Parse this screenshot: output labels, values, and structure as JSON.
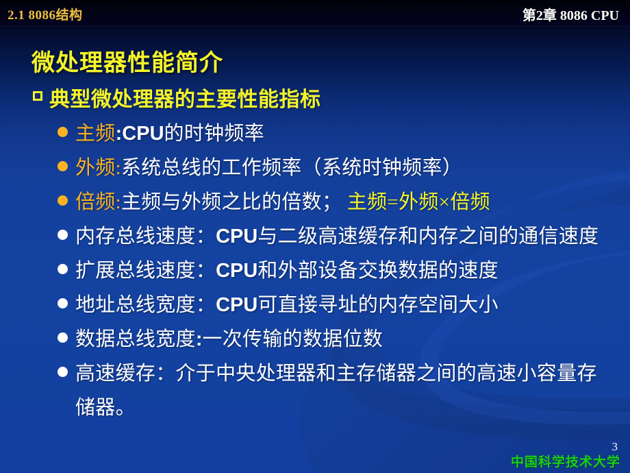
{
  "header": {
    "left_label": "2.1  8086结构",
    "right_label": "第2章 8086 CPU",
    "accent_gold": "#f0c040"
  },
  "title": "微处理器性能简介",
  "theme": {
    "background_top": "#02020e",
    "background_body": "#1340a0",
    "title_yellow": "#f5f52a",
    "bullet_gold": "#f9b223",
    "bullet_white": "#ffffff",
    "footer_green": "#19d119"
  },
  "content": {
    "level1": {
      "bullet_glyph": "square-outline",
      "text": "典型微处理器的主要性能指标"
    },
    "items": [
      {
        "bullet": "gold",
        "segments": [
          {
            "text": "主频",
            "style": "gold"
          },
          {
            "text": ":",
            "style": "white-bold-latin"
          },
          {
            "text": "CPU",
            "style": "white-bold-latin"
          },
          {
            "text": "的时钟频率",
            "style": "white"
          }
        ]
      },
      {
        "bullet": "gold",
        "segments": [
          {
            "text": "外频:",
            "style": "gold"
          },
          {
            "text": "系统总线的工作频率（系统时钟频率）",
            "style": "white"
          }
        ]
      },
      {
        "bullet": "gold",
        "segments": [
          {
            "text": "倍频:",
            "style": "gold"
          },
          {
            "text": "主频与外频之比的倍数；  ",
            "style": "white"
          },
          {
            "text": "主频=外频×倍频",
            "style": "yellow"
          }
        ]
      },
      {
        "bullet": "white",
        "wrap": true,
        "segments": [
          {
            "text": "内存总线速度：",
            "style": "white"
          },
          {
            "text": "CPU",
            "style": "white-bold-latin"
          },
          {
            "text": "与二级高速缓存和内存之间的通信速度",
            "style": "white"
          }
        ]
      },
      {
        "bullet": "white",
        "segments": [
          {
            "text": "扩展总线速度：",
            "style": "white"
          },
          {
            "text": "CPU",
            "style": "white-bold-latin"
          },
          {
            "text": "和外部设备交换数据的速度",
            "style": "white"
          }
        ]
      },
      {
        "bullet": "white",
        "segments": [
          {
            "text": "地址总线宽度：",
            "style": "white"
          },
          {
            "text": "CPU",
            "style": "white-bold-latin"
          },
          {
            "text": "可直接寻址的内存空间大小",
            "style": "white"
          }
        ]
      },
      {
        "bullet": "white",
        "segments": [
          {
            "text": "数据总线宽度",
            "style": "white"
          },
          {
            "text": ":",
            "style": "white-bold-latin"
          },
          {
            "text": "一次传输的数据位数",
            "style": "white"
          }
        ]
      },
      {
        "bullet": "white",
        "wrap": true,
        "segments": [
          {
            "text": "高速缓存：介于中央处理器和主存储器之间的高速小容量存储器。",
            "style": "white"
          }
        ]
      }
    ]
  },
  "footer": {
    "organization": "中国科学技术大学",
    "page_number": "3"
  }
}
